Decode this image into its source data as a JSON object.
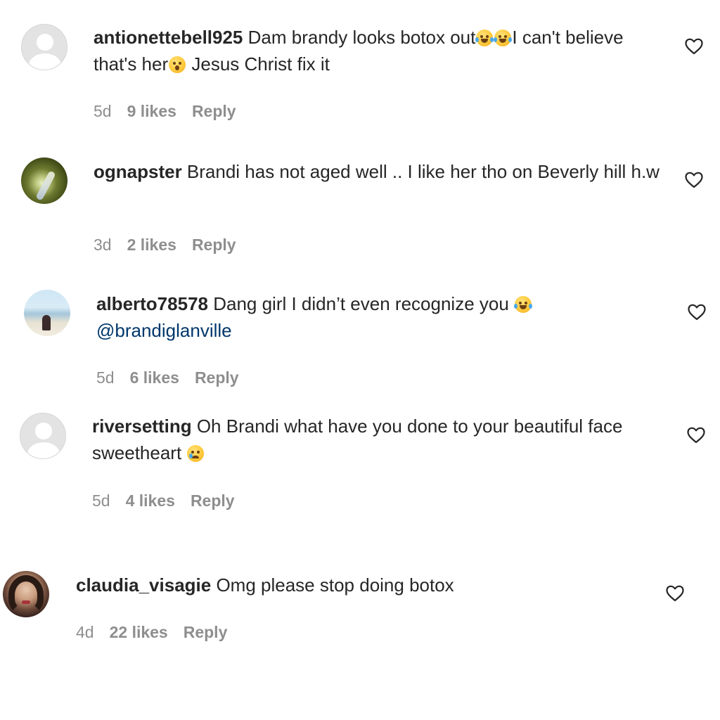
{
  "comments": [
    {
      "username": "antionettebell925",
      "text_part1": " Dam brandy looks botox out",
      "text_part2": "I can't believe that's her",
      "text_part3": " Jesus Christ fix it",
      "emoji1": "face-with-tears-of-joy",
      "emoji2": "face-with-tears-of-joy",
      "emoji3": "face-with-open-mouth",
      "age": "5d",
      "likes": "9 likes",
      "reply": "Reply"
    },
    {
      "username": "ognapster",
      "text_part1": " Brandi has not aged well .. I like her tho on Beverly hill h.w",
      "age": "3d",
      "likes": "2 likes",
      "reply": "Reply"
    },
    {
      "username": "alberto78578",
      "text_part1": " Dang girl I didn’t even recognize you ",
      "emoji1": "face-with-tears-of-joy",
      "mention": "@brandiglanville",
      "age": "5d",
      "likes": "6 likes",
      "reply": "Reply"
    },
    {
      "username": "riversetting",
      "text_part1": " Oh Brandi what have you done to your beautiful face sweetheart ",
      "emoji1": "crying-face",
      "age": "5d",
      "likes": "4 likes",
      "reply": "Reply"
    },
    {
      "username": "claudia_visagie",
      "text_part1": " Omg please stop doing botox",
      "age": "4d",
      "likes": "22 likes",
      "reply": "Reply"
    }
  ],
  "colors": {
    "text": "#262626",
    "meta": "#8e8e8e",
    "mention": "#00376b",
    "background": "#ffffff"
  },
  "icons": {
    "like": "heart-outline-icon",
    "default_avatar": "default-avatar-icon"
  }
}
